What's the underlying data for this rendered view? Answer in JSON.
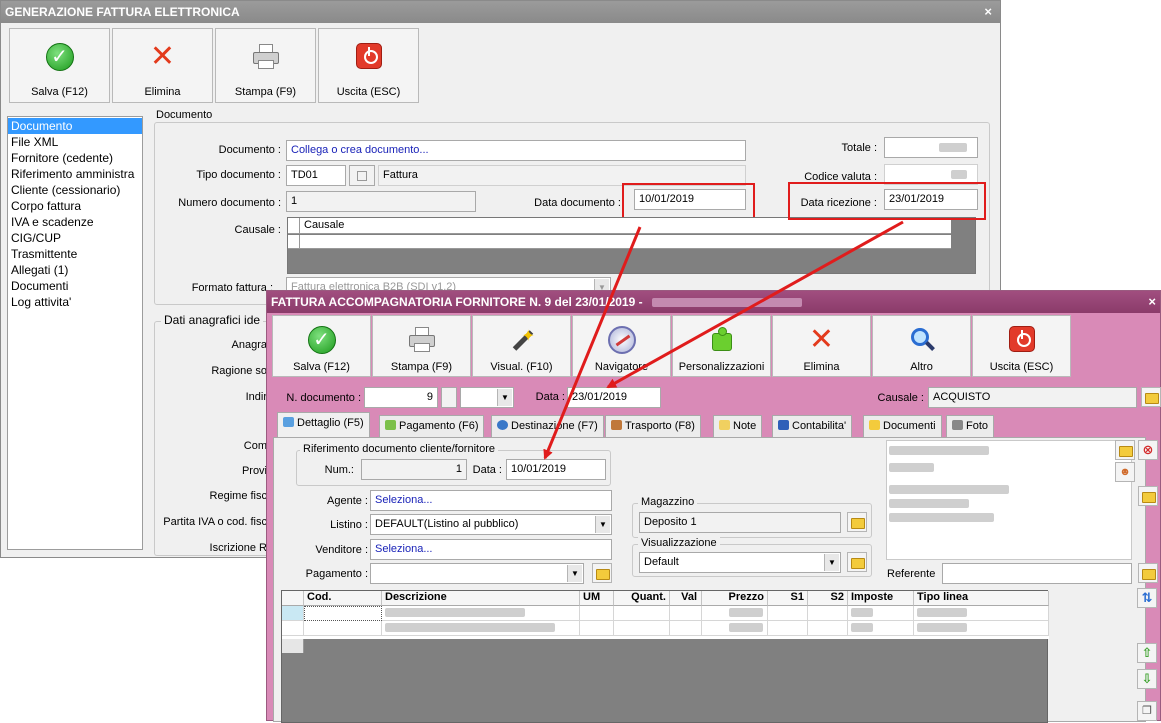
{
  "win1": {
    "title": "GENERAZIONE FATTURA ELETTRONICA",
    "close": "×",
    "toolbar": {
      "salva": "Salva (F12)",
      "elimina": "Elimina",
      "stampa": "Stampa (F9)",
      "uscita": "Uscita (ESC)"
    },
    "nav": [
      "Documento",
      "File XML",
      "Fornitore (cedente)",
      "Riferimento amministra",
      "Cliente (cessionario)",
      "Corpo fattura",
      "IVA e scadenze",
      "CIG/CUP",
      "Trasmittente",
      "Allegati (1)",
      "Documenti",
      "Log attivita'"
    ],
    "documento": {
      "group": "Documento",
      "documento_label": "Documento :",
      "documento_value": "Collega o crea documento...",
      "tipo_label": "Tipo documento :",
      "tipo_code": "TD01",
      "tipo_desc": "Fattura",
      "numero_label": "Numero documento :",
      "numero_value": "1",
      "data_doc_label": "Data documento :",
      "data_doc_value": "10/01/2019",
      "causale_label": "Causale :",
      "causale_col": "Causale",
      "totale_label": "Totale :",
      "codice_valuta_label": "Codice valuta :",
      "data_ricezione_label": "Data ricezione :",
      "data_ricezione_value": "23/01/2019",
      "formato_label": "Formato fattura :",
      "formato_value": "Fattura elettronica B2B (SDI v1.2)"
    },
    "anagrafici": {
      "group": "Dati anagrafici ide",
      "labels": [
        "Anagra",
        "Ragione so",
        "Indir",
        "Com",
        "Provi",
        "Regime fisc",
        "Partita IVA o cod. fisc",
        "Iscrizione R"
      ]
    }
  },
  "win2": {
    "title": "FATTURA ACCOMPAGNATORIA FORNITORE N. 9 del 23/01/2019 -",
    "close": "×",
    "toolbar": {
      "salva": "Salva (F12)",
      "stampa": "Stampa (F9)",
      "visual": "Visual. (F10)",
      "navigatore": "Navigatore",
      "personalizzazioni": "Personalizzazioni",
      "elimina": "Elimina",
      "altro": "Altro",
      "uscita": "Uscita (ESC)"
    },
    "ndoc_label": "N. documento :",
    "ndoc_value": "9",
    "data_label": "Data :",
    "data_value": "23/01/2019",
    "causale_label": "Causale :",
    "causale_value": "ACQUISTO",
    "tabs": [
      "Dettaglio (F5)",
      "Pagamento (F6)",
      "Destinazione (F7)",
      "Trasporto (F8)",
      "Note",
      "Contabilita'",
      "Documenti",
      "Foto"
    ],
    "riferimento": {
      "group": "Riferimento documento cliente/fornitore",
      "num_label": "Num.:",
      "num_value": "1",
      "data_label": "Data :",
      "data_value": "10/01/2019"
    },
    "agente_label": "Agente :",
    "agente_value": "Seleziona...",
    "listino_label": "Listino :",
    "listino_value": "DEFAULT(Listino al pubblico)",
    "venditore_label": "Venditore :",
    "venditore_value": "Seleziona...",
    "pagamento_label": "Pagamento :",
    "magazzino_group": "Magazzino",
    "magazzino_value": "Deposito 1",
    "visualizzazione_group": "Visualizzazione",
    "visualizzazione_value": "Default",
    "referente_label": "Referente",
    "grid_headers": [
      "Cod.",
      "Descrizione",
      "UM",
      "Quant.",
      "Val",
      "Prezzo",
      "S1",
      "S2",
      "Imposte",
      "Tipo linea"
    ]
  },
  "colors": {
    "highlight": "#e01c1c",
    "front_window": "#d98ab7",
    "selection": "#3399ff"
  },
  "icons": [
    "check-icon",
    "delete-x-icon",
    "printer-icon",
    "exit-power-icon",
    "magic-wand-icon",
    "compass-icon",
    "puzzle-icon",
    "search-icon",
    "folder-icon",
    "arrow-up-icon",
    "arrow-down-icon"
  ]
}
